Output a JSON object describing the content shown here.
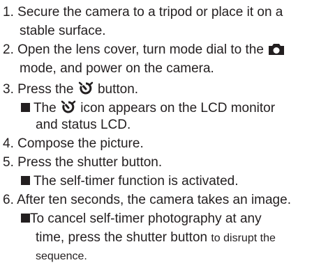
{
  "steps": {
    "s1": {
      "num": "1.",
      "line1": "Secure the camera to a tripod or place it on a",
      "line2": "stable surface."
    },
    "s2": {
      "num": "2.",
      "line1": "Open the lens cover, turn mode dial to the",
      "line2": "mode, and power on the camera."
    },
    "s3": {
      "num": "3.",
      "pre": "Press the",
      "post": "button."
    },
    "s3_note": {
      "pre": "The",
      "post": "icon appears on the LCD monitor",
      "line2": "and status LCD."
    },
    "s4": {
      "num": "4.",
      "text": "Compose the picture."
    },
    "s5": {
      "num": "5.",
      "text": "Press the shutter button."
    },
    "s5_note": {
      "text": "The self-timer function is activated."
    },
    "s6": {
      "num": "6.",
      "text": "After ten seconds, the camera takes an image."
    },
    "s6_note": {
      "line1": "To cancel self-timer photography at any",
      "line2a": "time, press the shutter button",
      "line2b": "to disrupt the",
      "line3": "sequence."
    }
  },
  "icons": {
    "camera": "camera-mode-icon",
    "self_timer": "self-timer-icon"
  },
  "colors": {
    "text": "#231f20",
    "background": "#ffffff"
  }
}
